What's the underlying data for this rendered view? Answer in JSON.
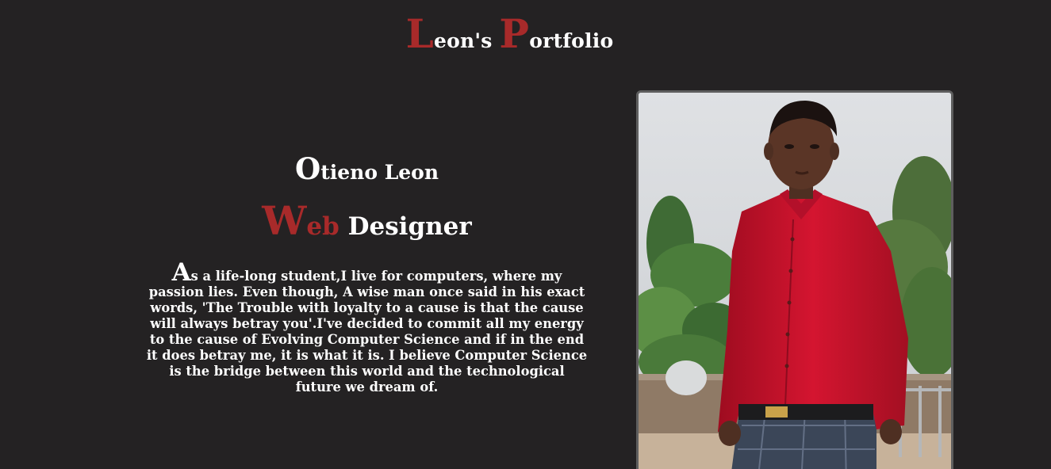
{
  "header": {
    "title_initial_1": "L",
    "title_rest_1": "eon's ",
    "title_initial_2": "P",
    "title_rest_2": "ortfolio"
  },
  "intro": {
    "name_initial": "O",
    "name_rest": "tieno Leon",
    "role_initial": "W",
    "role_red_rest": "eb",
    "role_rest": " Designer",
    "bio_initial": "A",
    "bio_rest": "s a life-long student,I live for computers, where my passion lies. Even though, A wise man once said in his exact words, 'The Trouble with loyalty to a cause is that the cause will always betray you'.I've decided to commit all my energy to the cause of Evolving Computer Science and if in the end it does betray me, it is what it is. I believe Computer Science is the bridge between this world and the technological future we dream of."
  },
  "photo": {
    "subject": "portrait-photo",
    "shirt_color": "#c8102e",
    "accent_color": "#a82a2a"
  }
}
